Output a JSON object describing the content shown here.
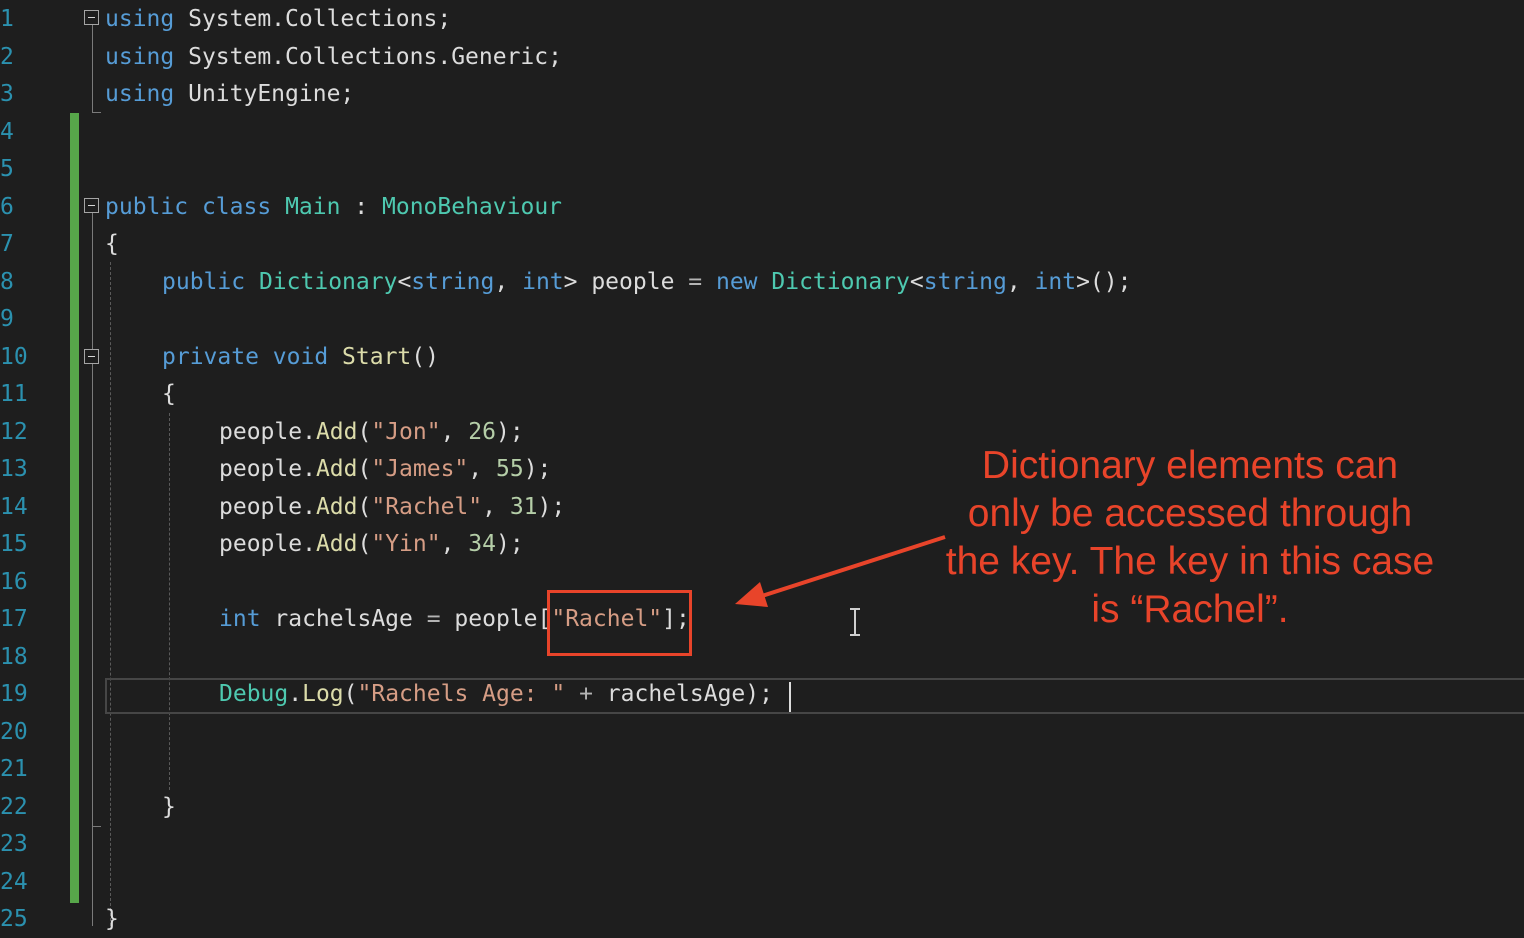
{
  "line_numbers": [
    "1",
    "2",
    "3",
    "4",
    "5",
    "6",
    "7",
    "8",
    "9",
    "10",
    "11",
    "12",
    "13",
    "14",
    "15",
    "16",
    "17",
    "18",
    "19",
    "20",
    "21",
    "22",
    "23",
    "24",
    "25"
  ],
  "code": {
    "l1": [
      "using",
      " System.Collections;"
    ],
    "l2": [
      "using",
      " System.Collections.Generic;"
    ],
    "l3": [
      "using",
      " UnityEngine;"
    ],
    "l6": [
      "public",
      " ",
      "class",
      " ",
      "Main",
      " : ",
      "MonoBehaviour"
    ],
    "l7": [
      "{"
    ],
    "l8": [
      "public",
      " ",
      "Dictionary",
      "<",
      "string",
      ", ",
      "int",
      "> people ",
      "=",
      " ",
      "new",
      " ",
      "Dictionary",
      "<",
      "string",
      ", ",
      "int",
      ">();"
    ],
    "l10": [
      "private",
      " ",
      "void",
      " ",
      "Start",
      "()"
    ],
    "l11": [
      "{"
    ],
    "l12": [
      "people.",
      "Add",
      "(",
      "\"Jon\"",
      ", ",
      "26",
      ");"
    ],
    "l13": [
      "people.",
      "Add",
      "(",
      "\"James\"",
      ", ",
      "55",
      ");"
    ],
    "l14": [
      "people.",
      "Add",
      "(",
      "\"Rachel\"",
      ", ",
      "31",
      ");"
    ],
    "l15": [
      "people.",
      "Add",
      "(",
      "\"Yin\"",
      ", ",
      "34",
      ");"
    ],
    "l17": [
      "int",
      " rachelsAge ",
      "=",
      " people[",
      "\"Rachel\"",
      "];"
    ],
    "l19": [
      "Debug",
      ".",
      "Log",
      "(",
      "\"Rachels Age: \"",
      " ",
      "+",
      " rachelsAge);"
    ],
    "l22": [
      "}"
    ],
    "l25": [
      "}"
    ]
  },
  "annotation": {
    "text": "Dictionary elements can only be accessed through the key. The key in this case is “Rachel”.",
    "color": "#e8442a"
  },
  "colors": {
    "background": "#1e1e1e",
    "keyword": "#569cd6",
    "type": "#4ec9b0",
    "method": "#dcdcaa",
    "string": "#d69d85",
    "number": "#b5cea8",
    "line_number": "#2b91af",
    "change_bar": "#57a64a"
  },
  "icons": [
    "fold-collapse-icon",
    "text-cursor-ibeam-icon",
    "arrow-pointer-icon"
  ]
}
